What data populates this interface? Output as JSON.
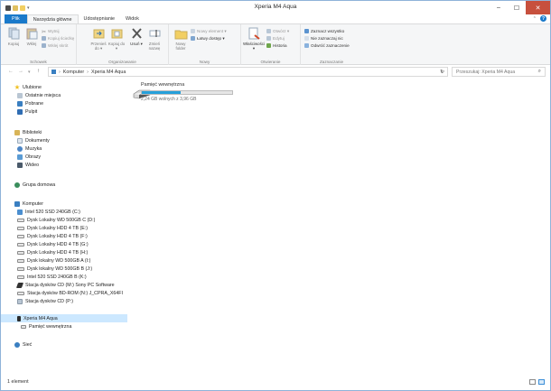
{
  "window": {
    "title": "Xperia M4 Aqua"
  },
  "tabs": [
    {
      "label": "Plik"
    },
    {
      "label": "Narzędzia główne"
    },
    {
      "label": "Udostępnianie"
    },
    {
      "label": "Widok"
    }
  ],
  "ribbon": {
    "schowek": {
      "label": "Schowek",
      "kopiuj": "Kopiuj",
      "wklej": "Wklej",
      "wytnij": "Wytnij",
      "kopiuj_sciezke": "Kopiuj ścieżkę",
      "wklej_skrot": "Wklej skrót"
    },
    "organizowanie": {
      "label": "Organizowanie",
      "przenies": "Przenieś do ▾",
      "kopiuj_do": "Kopiuj do ▾",
      "usun": "Usuń ▾",
      "zmien_nazwe": "Zmień nazwę"
    },
    "nowy": {
      "label": "Nowy",
      "nowy_folder": "Nowy folder",
      "nowy_element": "Nowy element ▾",
      "latwy_dostep": "Łatwy dostęp ▾"
    },
    "otwieranie": {
      "label": "Otwieranie",
      "wlasciwosci": "Właściwości ▾",
      "otworz": "Otwórz ▾",
      "edytuj": "Edytuj",
      "historia": "Historia"
    },
    "zaznaczanie": {
      "label": "Zaznaczanie",
      "zaznacz_wszystko": "Zaznacz wszystko",
      "nie_zaznaczaj": "Nie zaznaczaj nic",
      "odwroc": "Odwróć zaznaczenie"
    }
  },
  "address": {
    "crumbs": [
      "Komputer",
      "Xperia M4 Aqua"
    ],
    "search_placeholder": "Przeszukaj: Xperia M4 Aqua"
  },
  "nav": {
    "ulubione": "Ulubione",
    "ostatnie": "Ostatnie miejsca",
    "pobrane": "Pobrane",
    "pulpit": "Pulpit",
    "biblioteki": "Biblioteki",
    "dokumenty": "Dokumenty",
    "muzyka": "Muzyka",
    "obrazy": "Obrazy",
    "wideo": "Wideo",
    "grupa": "Grupa domowa",
    "komputer": "Komputer",
    "drives": [
      "Intel 520 SSD 240GB (C:)",
      "Dysk Lokalny WD 500GB C (D:)",
      "Dysk Lokalny HDD 4 TB (E:)",
      "Dysk Lokalny HDD 4 TB (F:)",
      "Dysk Lokalny HDD 4 TB (G:)",
      "Dysk Lokalny HDD 4 TB (H:)",
      "Dysk lokalny WD 500GB A (I:)",
      "Dysk lokalny WD 500GB B (J:)",
      "Intel 520 SSD 240GB B (K:)",
      "Stacja dysków CD (M:) Sony PC Software",
      "Stacja dysków BD-ROM (N:) J_CPRA_X64FI",
      "Stacja dysków CD (P:)"
    ],
    "xperia": "Xperia M4 Aqua",
    "pamiec": "Pamięć wewnętrzna",
    "siec": "Sieć"
  },
  "content": {
    "item_name": "Pamięć wewnętrzna",
    "item_free": "2,24 GB wolnych z 3,96 GB",
    "usage_fraction": 0.43
  },
  "status": {
    "count": "1 element"
  },
  "colors": {
    "accent": "#1979ca",
    "selection": "#cce8ff",
    "bar": "#26a0da",
    "close": "#c7503d"
  }
}
